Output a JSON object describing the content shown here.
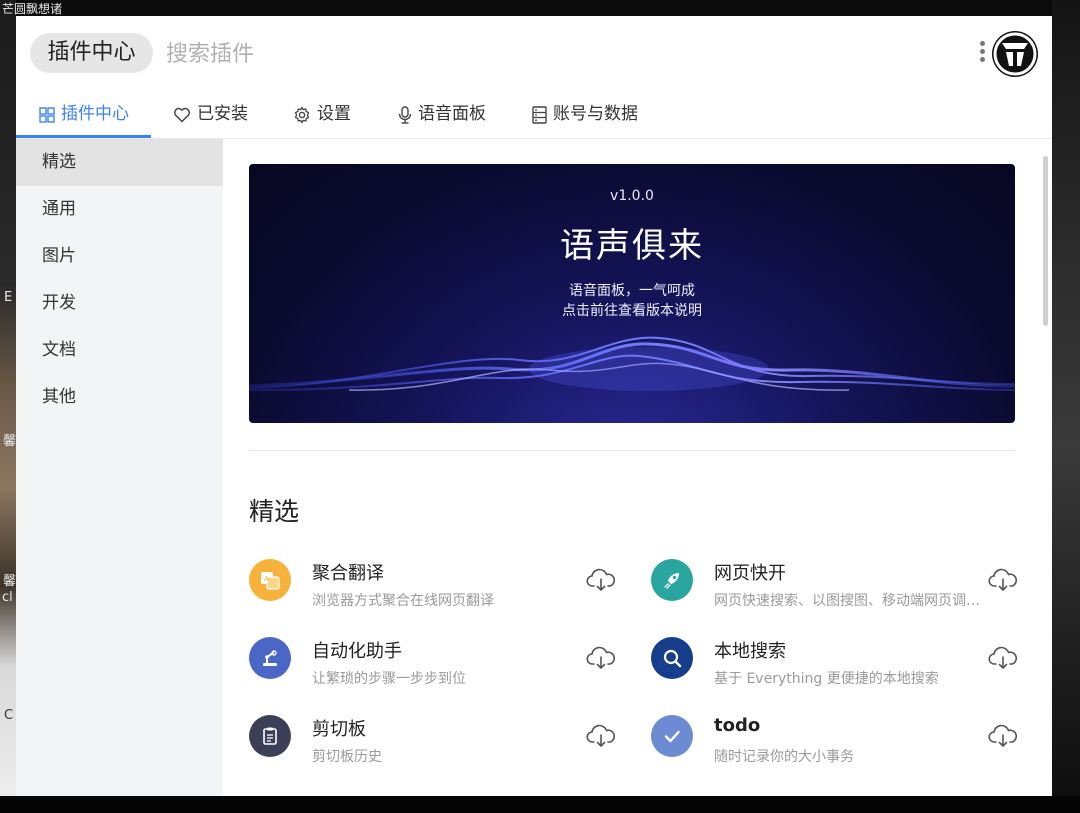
{
  "desktop": {
    "fragment_top_left": "芒圆飘想诸",
    "fragment_b": "E",
    "fragment_c": "馨",
    "fragment_d": "馨",
    "fragment_e": "cl",
    "fragment_f": "C"
  },
  "header": {
    "title_pill": "插件中心",
    "search_placeholder": "搜索插件"
  },
  "tabs": [
    {
      "label": "插件中心",
      "icon": "grid-icon",
      "active": true
    },
    {
      "label": "已安装",
      "icon": "heart-icon"
    },
    {
      "label": "设置",
      "icon": "gear-icon"
    },
    {
      "label": "语音面板",
      "icon": "microphone-icon"
    },
    {
      "label": "账号与数据",
      "icon": "database-icon"
    }
  ],
  "sidebar": {
    "items": [
      {
        "label": "精选",
        "active": true
      },
      {
        "label": "通用"
      },
      {
        "label": "图片"
      },
      {
        "label": "开发"
      },
      {
        "label": "文档"
      },
      {
        "label": "其他"
      }
    ]
  },
  "banner": {
    "version": "v1.0.0",
    "title": "语声俱来",
    "line1": "语音面板，一气呵成",
    "line2": "点击前往查看版本说明"
  },
  "section": {
    "title": "精选"
  },
  "plugins": [
    {
      "name": "聚合翻译",
      "desc": "浏览器方式聚合在线网页翻译",
      "icon": "translate-icon",
      "color": "#f7b23b"
    },
    {
      "name": "网页快开",
      "desc": "网页快速搜索、以图搜图、移动端网页调试等",
      "icon": "rocket-icon",
      "color": "#2aa6a0"
    },
    {
      "name": "自动化助手",
      "desc": "让繁琐的步骤一步步到位",
      "icon": "robot-arm-icon",
      "color": "#4a67c7"
    },
    {
      "name": "本地搜索",
      "desc": "基于 Everything 更便捷的本地搜索",
      "icon": "magnifier-icon",
      "color": "#163e8c"
    },
    {
      "name": "剪切板",
      "desc": "剪切板历史",
      "icon": "clipboard-icon",
      "color": "#3b3f57"
    },
    {
      "name": "todo",
      "desc": "随时记录你的大小事务",
      "icon": "check-icon",
      "color": "#6c8bd3"
    }
  ],
  "colors": {
    "accent": "#3b82f6",
    "banner_bg": "#0a0a2e"
  }
}
